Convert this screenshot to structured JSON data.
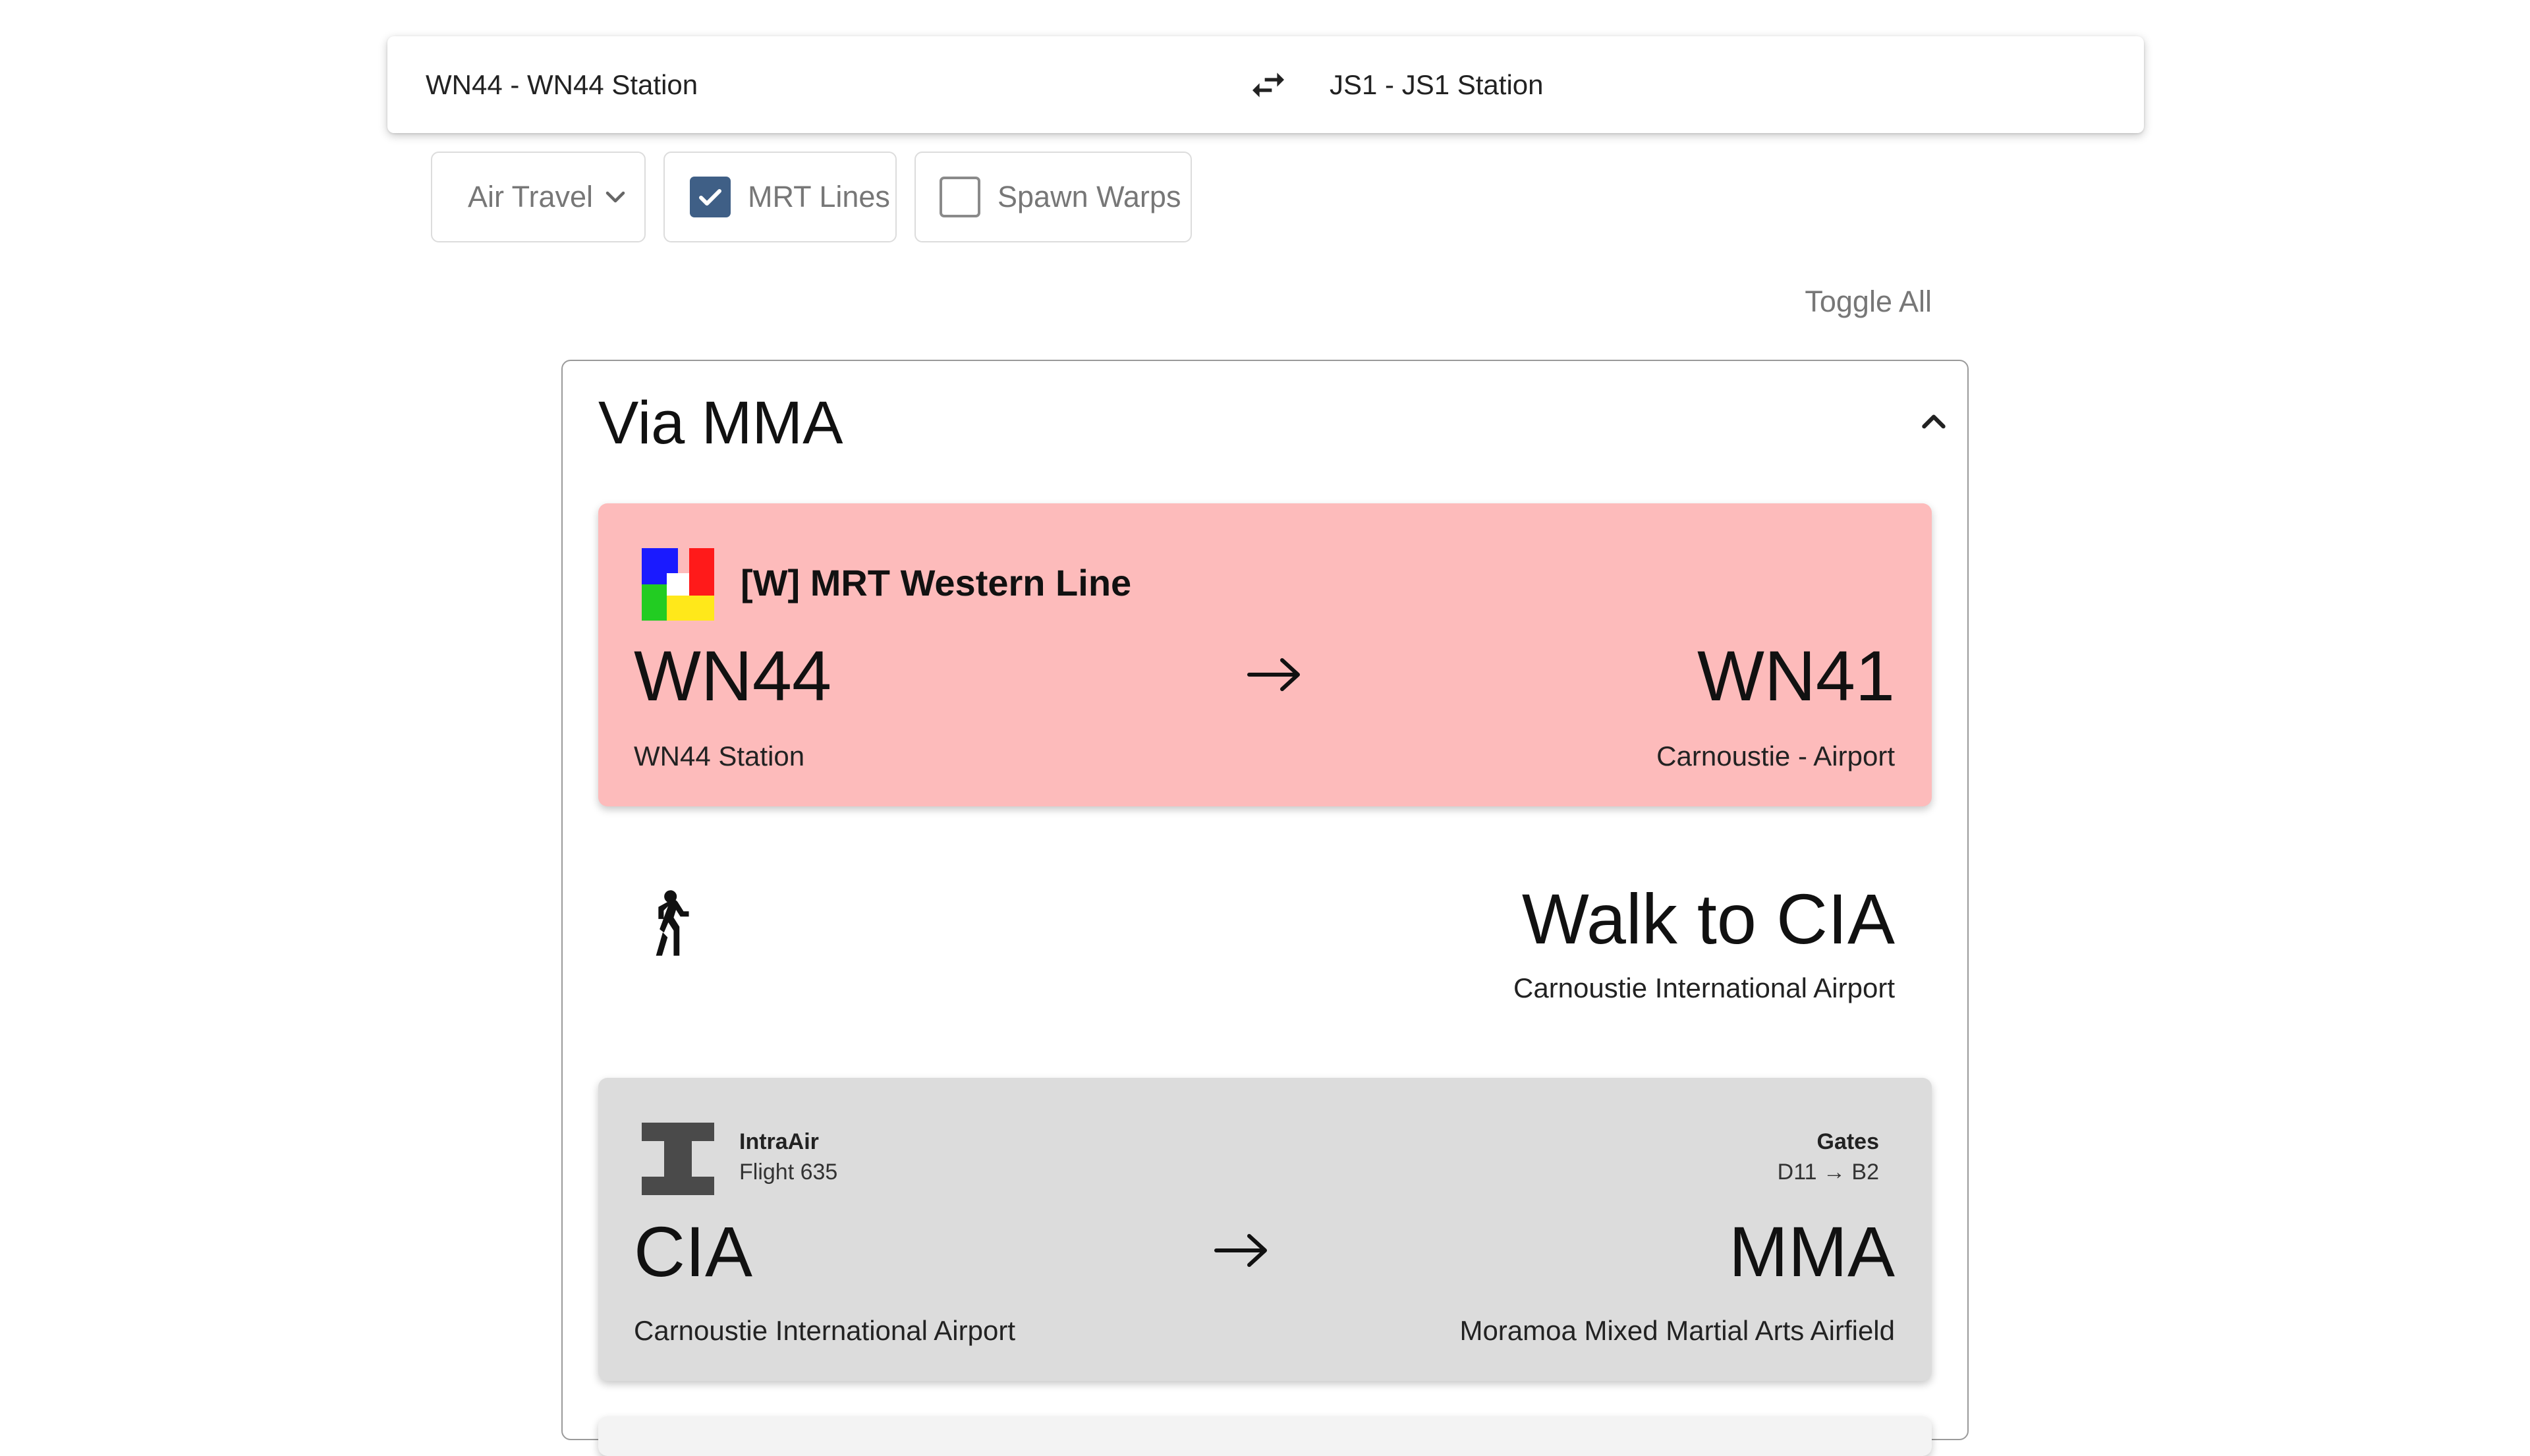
{
  "search": {
    "from": "WN44 - WN44 Station",
    "to": "JS1 - JS1 Station"
  },
  "filters": {
    "air_travel": "Air Travel",
    "mrt_lines": {
      "label": "MRT Lines",
      "checked": true
    },
    "spawn_warps": {
      "label": "Spawn Warps",
      "checked": false
    }
  },
  "toggle_all": "Toggle All",
  "route": {
    "title": "Via MMA",
    "legs": [
      {
        "type": "mrt",
        "line_name": "[W] MRT Western Line",
        "from_code": "WN44",
        "from_name": "WN44 Station",
        "to_code": "WN41",
        "to_name": "Carnoustie - Airport",
        "color": "#fdbbbb"
      },
      {
        "type": "walk",
        "title": "Walk to CIA",
        "subtitle": "Carnoustie International Airport"
      },
      {
        "type": "flight",
        "airline": "IntraAir",
        "flight": "Flight 635",
        "gates_label": "Gates",
        "gates": "D11 → B2",
        "from_code": "CIA",
        "from_name": "Carnoustie International Airport",
        "to_code": "MMA",
        "to_name": "Moramoa Mixed Martial Arts Airfield",
        "color": "#dcdcdc"
      }
    ]
  },
  "icons": {
    "swap": "swap-arrows-icon",
    "dropdown": "chevron-down-icon",
    "check": "checkmark-icon",
    "collapse": "chevron-up-icon",
    "arrow": "arrow-right-icon",
    "walk": "pedestrian-icon",
    "mrt_logo": "mrt-logo-icon",
    "airline_logo": "intraair-logo-icon"
  },
  "colors": {
    "mrt_card": "#fdbbbb",
    "flight_card": "#dcdcdc",
    "checkbox": "#3f5f86"
  }
}
